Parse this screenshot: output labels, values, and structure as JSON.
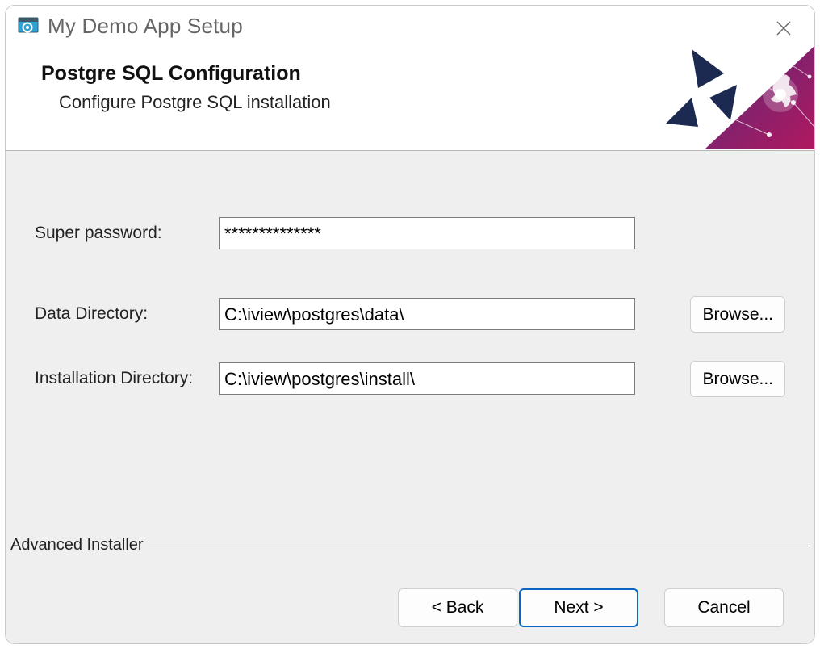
{
  "window": {
    "title": "My Demo App Setup"
  },
  "header": {
    "title": "Postgre SQL Configuration",
    "subtitle": "Configure Postgre SQL installation"
  },
  "form": {
    "password": {
      "label": "Super password:",
      "value": "**************"
    },
    "data_dir": {
      "label": "Data Directory:",
      "value": "C:\\iview\\postgres\\data\\",
      "browse_label": "Browse..."
    },
    "install_dir": {
      "label": "Installation Directory:",
      "value": "C:\\iview\\postgres\\install\\",
      "browse_label": "Browse..."
    }
  },
  "separator": "Advanced Installer",
  "footer": {
    "back_label": "< Back",
    "next_label": "Next >",
    "cancel_label": "Cancel"
  }
}
